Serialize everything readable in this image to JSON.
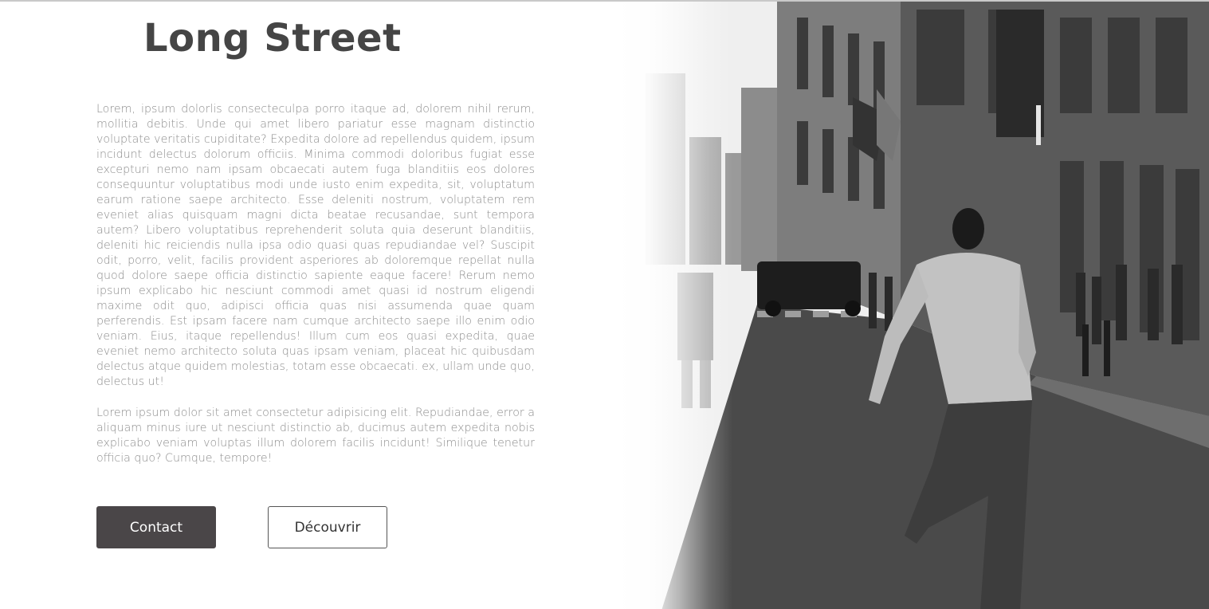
{
  "header": {
    "title": "Long Street"
  },
  "content": {
    "paragraph_1": "Lorem, ipsum dolorlis consecteculpa porro itaque ad, dolorem nihil rerum, mollitia debitis. Unde qui amet libero pariatur esse magnam distinctio voluptate veritatis cupiditate? Expedita dolore ad repellendus quidem, ipsum incidunt delectus dolorum officiis. Minima commodi doloribus fugiat esse excepturi nemo nam ipsam obcaecati autem fuga blanditiis eos dolores consequuntur voluptatibus modi unde iusto enim expedita, sit, voluptatum earum ratione saepe architecto. Esse deleniti nostrum, voluptatem rem eveniet alias quisquam magni dicta beatae recusandae, sunt tempora autem? Libero voluptatibus reprehenderit soluta quia deserunt blanditiis, deleniti hic reiciendis nulla ipsa odio quasi quas repudiandae vel? Suscipit odit, porro, velit, facilis provident asperiores ab doloremque repellat nulla quod dolore saepe officia distinctio sapiente eaque facere! Rerum nemo ipsum explicabo hic nesciunt commodi amet quasi id nostrum eligendi maxime odit quo, adipisci officia quas nisi assumenda quae quam perferendis. Est ipsam facere nam cumque architecto saepe illo enim odio veniam. Eius, itaque repellendus! Illum cum eos quasi expedita, quae eveniet nemo architecto soluta quas ipsam veniam, placeat hic quibusdam delectus atque quidem molestias, totam esse obcaecati. ex, ullam unde quo, delectus ut!",
    "paragraph_2": "Lorem ipsum dolor sit amet consectetur adipisicing elit. Repudiandae, error a aliquam minus iure ut nesciunt distinctio ab, ducimus autem expedita nobis explicabo veniam voluptas illum dolorem facilis incidunt! Similique tenetur officia quo? Cumque, tempore!"
  },
  "actions": {
    "contact_label": "Contact",
    "discover_label": "Découvrir"
  },
  "image": {
    "description": "black-and-white street photo",
    "colors": {
      "sky": "#f2f2f2",
      "building_dark": "#3a3a3a",
      "building_mid": "#6a6a6a",
      "road": "#4b4b4b",
      "sidewalk": "#5c5c5c"
    }
  }
}
